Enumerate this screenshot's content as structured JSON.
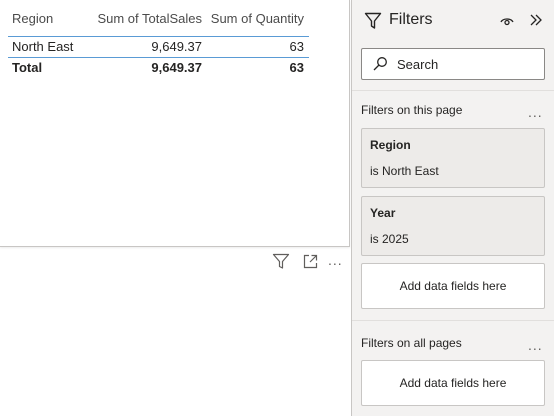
{
  "table": {
    "headers": [
      "Region",
      "Sum of TotalSales",
      "Sum of Quantity"
    ],
    "rows": [
      [
        "North East",
        "9,649.37",
        "63"
      ]
    ],
    "total": [
      "Total",
      "9,649.37",
      "63"
    ]
  },
  "visual_icons": [
    "filter-icon",
    "focus-mode-icon",
    "more-options-icon"
  ],
  "filters_pane": {
    "title": "Filters",
    "search_placeholder": "Search",
    "on_this_page_label": "Filters on this page",
    "cards": [
      {
        "name": "Region",
        "value": "is North East"
      },
      {
        "name": "Year",
        "value": "is 2025"
      }
    ],
    "add_fields_label": "Add data fields here",
    "on_all_pages_label": "Filters on all pages",
    "more_label": "..."
  },
  "colors": {
    "row_border": "#5a9bd5",
    "pane_bg": "#f3f2f1",
    "card_bg": "#edebe9"
  }
}
